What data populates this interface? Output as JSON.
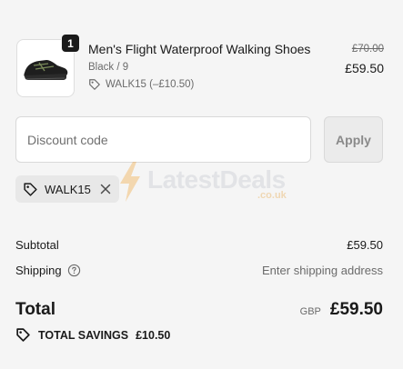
{
  "cart": {
    "item": {
      "quantity": "1",
      "title": "Men's Flight Waterproof Walking Shoes",
      "variant": "Black / 9",
      "discount_line": "WALK15 (–£10.50)",
      "original_price": "£70.00",
      "price": "£59.50",
      "image_icon": "shoe-image"
    }
  },
  "discount": {
    "placeholder": "Discount code",
    "value": "",
    "apply_label": "Apply",
    "applied_code": "WALK15"
  },
  "watermark": {
    "text": "LatestDeals",
    "sub": ".co.uk"
  },
  "summary": {
    "subtotal_label": "Subtotal",
    "subtotal_value": "£59.50",
    "shipping_label": "Shipping",
    "shipping_value": "Enter shipping address",
    "total_label": "Total",
    "currency": "GBP",
    "total_value": "£59.50",
    "savings_label": "TOTAL SAVINGS",
    "savings_value": "£10.50"
  },
  "colors": {
    "background": "#f5f5f5",
    "text": "#1a1a1a",
    "muted": "#6b6b6b",
    "badge": "#1a1a1a"
  }
}
